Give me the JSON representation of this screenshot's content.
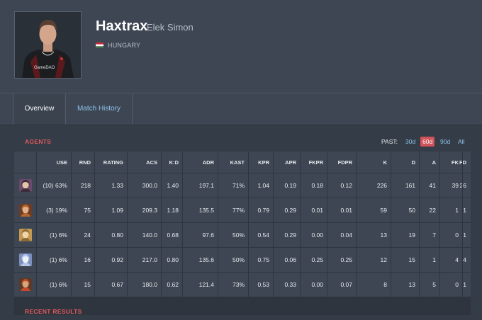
{
  "player": {
    "alias": "Haxtrax",
    "real_name": "Elek Simon",
    "country": "HUNGARY",
    "photo_shirt_text": "GameDAO"
  },
  "tabs": [
    {
      "label": "Overview",
      "active": true
    },
    {
      "label": "Match History",
      "active": false
    }
  ],
  "agents_section": {
    "title": "AGENTS",
    "past_label": "PAST:",
    "past_options": [
      "30d",
      "60d",
      "90d",
      "All"
    ],
    "past_selected": "60d"
  },
  "table": {
    "headers": [
      "",
      "USE",
      "RND",
      "RATING",
      "ACS",
      "K:D",
      "ADR",
      "KAST",
      "KPR",
      "APR",
      "FKPR",
      "FDPR",
      "K",
      "D",
      "A",
      "FK",
      "FD"
    ],
    "rows": [
      {
        "agent_icon": "agent-icon-1",
        "cells": [
          "(10) 63%",
          "218",
          "1.33",
          "300.0",
          "1.40",
          "197.1",
          "71%",
          "1.04",
          "0.19",
          "0.18",
          "0.12",
          "226",
          "161",
          "41",
          "39",
          "26"
        ]
      },
      {
        "agent_icon": "agent-icon-2",
        "cells": [
          "(3) 19%",
          "75",
          "1.09",
          "209.3",
          "1.18",
          "135.5",
          "77%",
          "0.79",
          "0.29",
          "0.01",
          "0.01",
          "59",
          "50",
          "22",
          "1",
          "1"
        ]
      },
      {
        "agent_icon": "agent-icon-3",
        "cells": [
          "(1) 6%",
          "24",
          "0.80",
          "140.0",
          "0.68",
          "97.6",
          "50%",
          "0.54",
          "0.29",
          "0.00",
          "0.04",
          "13",
          "19",
          "7",
          "0",
          "1"
        ]
      },
      {
        "agent_icon": "agent-icon-4",
        "cells": [
          "(1) 6%",
          "16",
          "0.92",
          "217.0",
          "0.80",
          "135.6",
          "50%",
          "0.75",
          "0.06",
          "0.25",
          "0.25",
          "12",
          "15",
          "1",
          "4",
          "4"
        ]
      },
      {
        "agent_icon": "agent-icon-5",
        "cells": [
          "(1) 6%",
          "15",
          "0.67",
          "180.0",
          "0.62",
          "121.4",
          "73%",
          "0.53",
          "0.33",
          "0.00",
          "0.07",
          "8",
          "13",
          "5",
          "0",
          "1"
        ]
      }
    ]
  },
  "recent_results": {
    "title": "RECENT RESULTS"
  },
  "colors": {
    "accent_red": "#e25a5a",
    "link_blue": "#8fc3ea",
    "selected_pill": "#d1535a"
  }
}
